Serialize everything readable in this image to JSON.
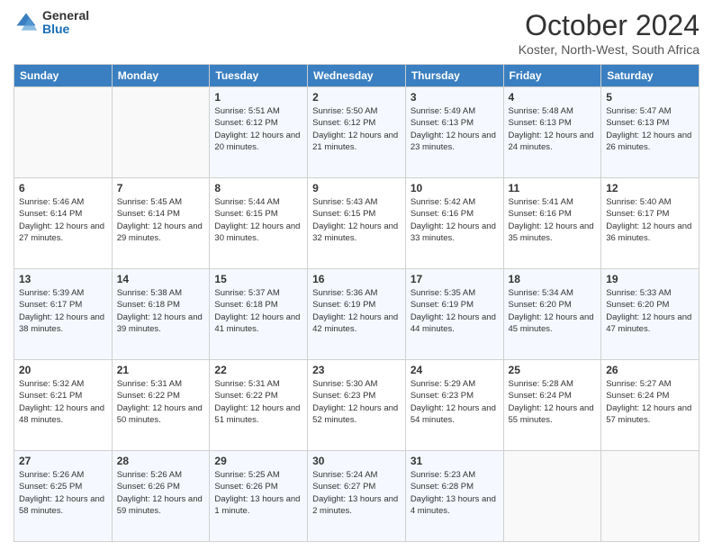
{
  "logo": {
    "general": "General",
    "blue": "Blue"
  },
  "header": {
    "title": "October 2024",
    "subtitle": "Koster, North-West, South Africa"
  },
  "weekdays": [
    "Sunday",
    "Monday",
    "Tuesday",
    "Wednesday",
    "Thursday",
    "Friday",
    "Saturday"
  ],
  "weeks": [
    [
      {
        "day": "",
        "sunrise": "",
        "sunset": "",
        "daylight": ""
      },
      {
        "day": "",
        "sunrise": "",
        "sunset": "",
        "daylight": ""
      },
      {
        "day": "1",
        "sunrise": "Sunrise: 5:51 AM",
        "sunset": "Sunset: 6:12 PM",
        "daylight": "Daylight: 12 hours and 20 minutes."
      },
      {
        "day": "2",
        "sunrise": "Sunrise: 5:50 AM",
        "sunset": "Sunset: 6:12 PM",
        "daylight": "Daylight: 12 hours and 21 minutes."
      },
      {
        "day": "3",
        "sunrise": "Sunrise: 5:49 AM",
        "sunset": "Sunset: 6:13 PM",
        "daylight": "Daylight: 12 hours and 23 minutes."
      },
      {
        "day": "4",
        "sunrise": "Sunrise: 5:48 AM",
        "sunset": "Sunset: 6:13 PM",
        "daylight": "Daylight: 12 hours and 24 minutes."
      },
      {
        "day": "5",
        "sunrise": "Sunrise: 5:47 AM",
        "sunset": "Sunset: 6:13 PM",
        "daylight": "Daylight: 12 hours and 26 minutes."
      }
    ],
    [
      {
        "day": "6",
        "sunrise": "Sunrise: 5:46 AM",
        "sunset": "Sunset: 6:14 PM",
        "daylight": "Daylight: 12 hours and 27 minutes."
      },
      {
        "day": "7",
        "sunrise": "Sunrise: 5:45 AM",
        "sunset": "Sunset: 6:14 PM",
        "daylight": "Daylight: 12 hours and 29 minutes."
      },
      {
        "day": "8",
        "sunrise": "Sunrise: 5:44 AM",
        "sunset": "Sunset: 6:15 PM",
        "daylight": "Daylight: 12 hours and 30 minutes."
      },
      {
        "day": "9",
        "sunrise": "Sunrise: 5:43 AM",
        "sunset": "Sunset: 6:15 PM",
        "daylight": "Daylight: 12 hours and 32 minutes."
      },
      {
        "day": "10",
        "sunrise": "Sunrise: 5:42 AM",
        "sunset": "Sunset: 6:16 PM",
        "daylight": "Daylight: 12 hours and 33 minutes."
      },
      {
        "day": "11",
        "sunrise": "Sunrise: 5:41 AM",
        "sunset": "Sunset: 6:16 PM",
        "daylight": "Daylight: 12 hours and 35 minutes."
      },
      {
        "day": "12",
        "sunrise": "Sunrise: 5:40 AM",
        "sunset": "Sunset: 6:17 PM",
        "daylight": "Daylight: 12 hours and 36 minutes."
      }
    ],
    [
      {
        "day": "13",
        "sunrise": "Sunrise: 5:39 AM",
        "sunset": "Sunset: 6:17 PM",
        "daylight": "Daylight: 12 hours and 38 minutes."
      },
      {
        "day": "14",
        "sunrise": "Sunrise: 5:38 AM",
        "sunset": "Sunset: 6:18 PM",
        "daylight": "Daylight: 12 hours and 39 minutes."
      },
      {
        "day": "15",
        "sunrise": "Sunrise: 5:37 AM",
        "sunset": "Sunset: 6:18 PM",
        "daylight": "Daylight: 12 hours and 41 minutes."
      },
      {
        "day": "16",
        "sunrise": "Sunrise: 5:36 AM",
        "sunset": "Sunset: 6:19 PM",
        "daylight": "Daylight: 12 hours and 42 minutes."
      },
      {
        "day": "17",
        "sunrise": "Sunrise: 5:35 AM",
        "sunset": "Sunset: 6:19 PM",
        "daylight": "Daylight: 12 hours and 44 minutes."
      },
      {
        "day": "18",
        "sunrise": "Sunrise: 5:34 AM",
        "sunset": "Sunset: 6:20 PM",
        "daylight": "Daylight: 12 hours and 45 minutes."
      },
      {
        "day": "19",
        "sunrise": "Sunrise: 5:33 AM",
        "sunset": "Sunset: 6:20 PM",
        "daylight": "Daylight: 12 hours and 47 minutes."
      }
    ],
    [
      {
        "day": "20",
        "sunrise": "Sunrise: 5:32 AM",
        "sunset": "Sunset: 6:21 PM",
        "daylight": "Daylight: 12 hours and 48 minutes."
      },
      {
        "day": "21",
        "sunrise": "Sunrise: 5:31 AM",
        "sunset": "Sunset: 6:22 PM",
        "daylight": "Daylight: 12 hours and 50 minutes."
      },
      {
        "day": "22",
        "sunrise": "Sunrise: 5:31 AM",
        "sunset": "Sunset: 6:22 PM",
        "daylight": "Daylight: 12 hours and 51 minutes."
      },
      {
        "day": "23",
        "sunrise": "Sunrise: 5:30 AM",
        "sunset": "Sunset: 6:23 PM",
        "daylight": "Daylight: 12 hours and 52 minutes."
      },
      {
        "day": "24",
        "sunrise": "Sunrise: 5:29 AM",
        "sunset": "Sunset: 6:23 PM",
        "daylight": "Daylight: 12 hours and 54 minutes."
      },
      {
        "day": "25",
        "sunrise": "Sunrise: 5:28 AM",
        "sunset": "Sunset: 6:24 PM",
        "daylight": "Daylight: 12 hours and 55 minutes."
      },
      {
        "day": "26",
        "sunrise": "Sunrise: 5:27 AM",
        "sunset": "Sunset: 6:24 PM",
        "daylight": "Daylight: 12 hours and 57 minutes."
      }
    ],
    [
      {
        "day": "27",
        "sunrise": "Sunrise: 5:26 AM",
        "sunset": "Sunset: 6:25 PM",
        "daylight": "Daylight: 12 hours and 58 minutes."
      },
      {
        "day": "28",
        "sunrise": "Sunrise: 5:26 AM",
        "sunset": "Sunset: 6:26 PM",
        "daylight": "Daylight: 12 hours and 59 minutes."
      },
      {
        "day": "29",
        "sunrise": "Sunrise: 5:25 AM",
        "sunset": "Sunset: 6:26 PM",
        "daylight": "Daylight: 13 hours and 1 minute."
      },
      {
        "day": "30",
        "sunrise": "Sunrise: 5:24 AM",
        "sunset": "Sunset: 6:27 PM",
        "daylight": "Daylight: 13 hours and 2 minutes."
      },
      {
        "day": "31",
        "sunrise": "Sunrise: 5:23 AM",
        "sunset": "Sunset: 6:28 PM",
        "daylight": "Daylight: 13 hours and 4 minutes."
      },
      {
        "day": "",
        "sunrise": "",
        "sunset": "",
        "daylight": ""
      },
      {
        "day": "",
        "sunrise": "",
        "sunset": "",
        "daylight": ""
      }
    ]
  ]
}
